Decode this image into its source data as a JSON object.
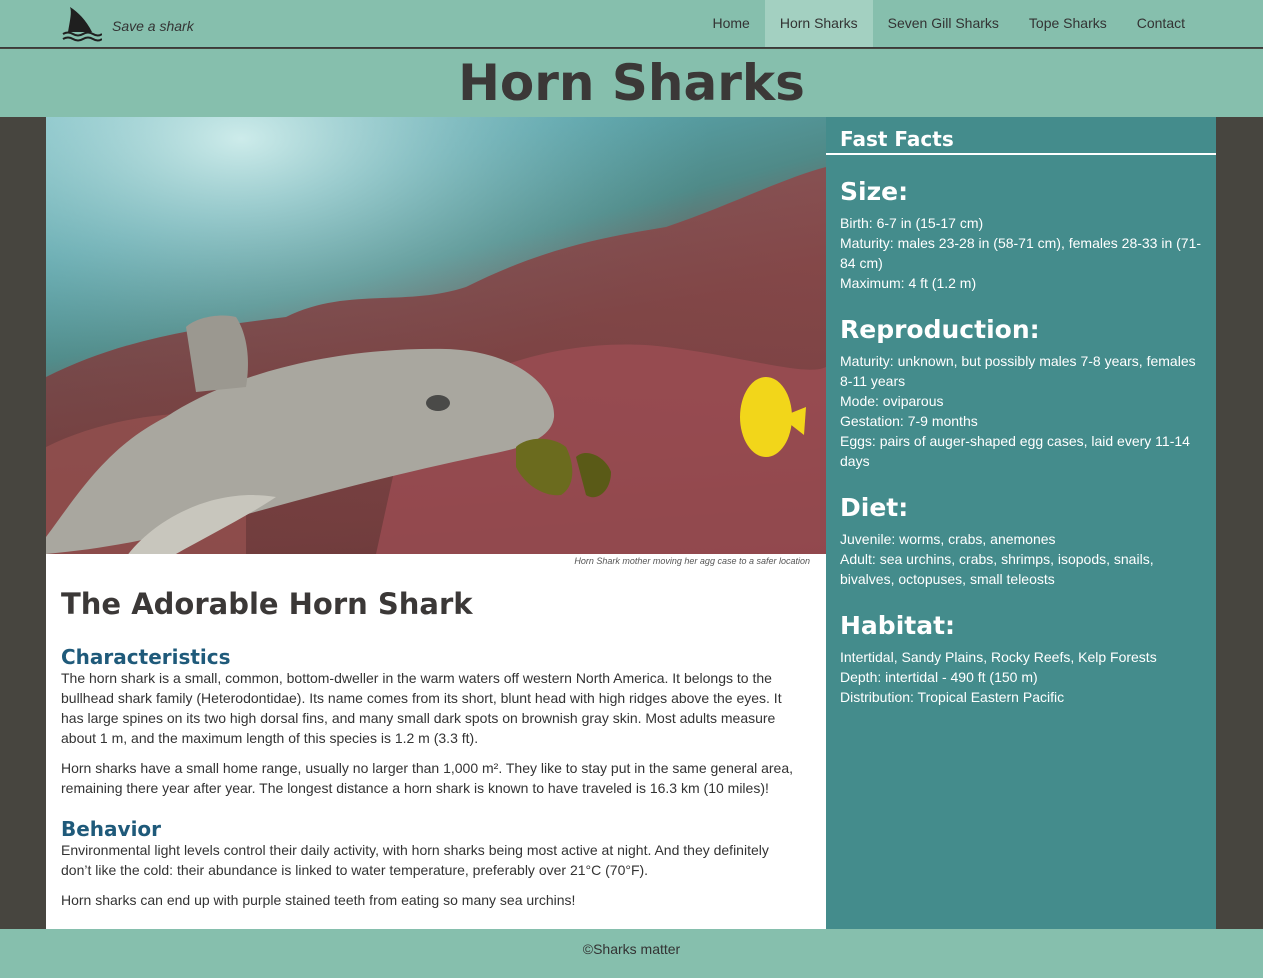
{
  "nav": {
    "brand": "Save a shark",
    "items": [
      {
        "label": "Home",
        "active": false
      },
      {
        "label": "Horn Sharks",
        "active": true
      },
      {
        "label": "Seven Gill Sharks",
        "active": false
      },
      {
        "label": "Tope Sharks",
        "active": false
      },
      {
        "label": "Contact",
        "active": false
      }
    ]
  },
  "page_title": "Horn Sharks",
  "hero": {
    "caption": "Horn Shark mother moving her agg case to a safer location"
  },
  "article": {
    "title": "The Adorable Horn Shark",
    "characteristics_heading": "Characteristics",
    "characteristics_p1": "The horn shark is a small, common, bottom-dweller in the warm waters off western North America. It belongs to the bullhead shark family (Heterodontidae). Its name comes from its short, blunt head with high ridges above the eyes. It has large spines on its two high dorsal fins, and many small dark spots on brownish gray skin. Most adults measure about 1 m, and the maximum length of this species is 1.2 m (3.3 ft).",
    "characteristics_p2": "Horn sharks have a small home range, usually no larger than 1,000 m². They like to stay put in the same general area, remaining there year after year. The longest distance a horn shark is known to have traveled is 16.3 km (10 miles)!",
    "behavior_heading": "Behavior",
    "behavior_p1": "Environmental light levels control their daily activity, with horn sharks being most active at night. And they definitely don’t like the cold: their abundance is linked to water temperature, preferably over 21°C (70°F).",
    "behavior_p2": "Horn sharks can end up with purple stained teeth from eating so many sea urchins!"
  },
  "facts": {
    "title": "Fast Facts",
    "size_heading": "Size:",
    "size_lines": [
      "Birth: 6-7 in (15-17 cm)",
      "Maturity: males 23-28 in (58-71 cm), females 28-33 in (71-84 cm)",
      "Maximum: 4 ft (1.2 m)"
    ],
    "reproduction_heading": "Reproduction:",
    "reproduction_lines": [
      "Maturity: unknown, but possibly males 7-8 years, females 8-11 years",
      "Mode: oviparous",
      "Gestation: 7-9 months",
      "Eggs: pairs of auger-shaped egg cases, laid every 11-14 days"
    ],
    "diet_heading": "Diet:",
    "diet_lines": [
      "Juvenile: worms, crabs, anemones",
      "Adult: sea urchins, crabs, shrimps, isopods, snails, bivalves, octopuses, small teleosts"
    ],
    "habitat_heading": "Habitat:",
    "habitat_lines": [
      "Intertidal, Sandy Plains, Rocky Reefs, Kelp Forests",
      "Depth: intertidal - 490 ft (150 m)",
      "Distribution: Tropical Eastern Pacific"
    ]
  },
  "footer": "©Sharks matter",
  "colors": {
    "header_bg": "#86bfad",
    "nav_active_bg": "#a3d0c1",
    "facts_bg": "#448c8c",
    "page_bg": "#47453f",
    "subheading": "#1f5a7a",
    "title_text": "#3b3837"
  },
  "icons": {
    "brand": "shark-fin-icon"
  }
}
